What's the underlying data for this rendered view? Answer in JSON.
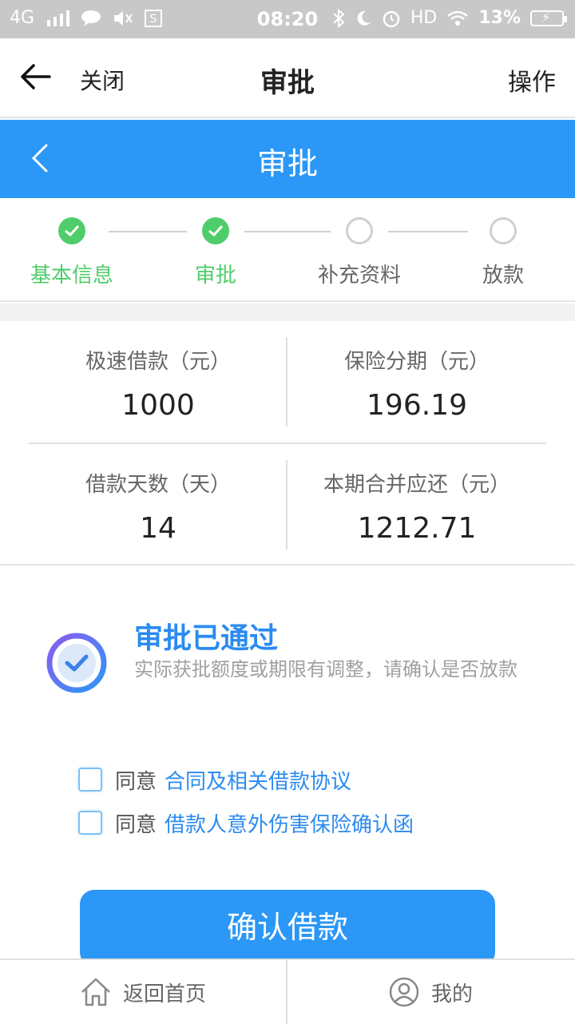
{
  "status_bar": {
    "network": "4G",
    "time": "08:20",
    "hd": "HD",
    "battery": "13%"
  },
  "app_bar": {
    "close_label": "关闭",
    "title": "审批",
    "action_label": "操作"
  },
  "sub_header": {
    "title": "审批"
  },
  "steps": [
    {
      "label": "基本信息",
      "state": "done"
    },
    {
      "label": "审批",
      "state": "done"
    },
    {
      "label": "补充资料",
      "state": "todo"
    },
    {
      "label": "放款",
      "state": "todo"
    }
  ],
  "stats": {
    "loan_amount": {
      "label": "极速借款（元）",
      "value": "1000"
    },
    "insurance": {
      "label": "保险分期（元）",
      "value": "196.19"
    },
    "loan_days": {
      "label": "借款天数（天）",
      "value": "14"
    },
    "total_due": {
      "label": "本期合并应还（元）",
      "value": "1212.71"
    }
  },
  "result": {
    "headline": "审批已通过",
    "description": "实际获批额度或期限有调整，请确认是否放款"
  },
  "agreements": [
    {
      "prefix": "同意",
      "link": "合同及相关借款协议"
    },
    {
      "prefix": "同意",
      "link": "借款人意外伤害保险确认函"
    }
  ],
  "confirm_button": "确认借款",
  "tab_bar": {
    "home": "返回首页",
    "mine": "我的"
  },
  "colors": {
    "primary": "#2b97f6",
    "success": "#4fcd6a",
    "link": "#2b8bf0"
  }
}
